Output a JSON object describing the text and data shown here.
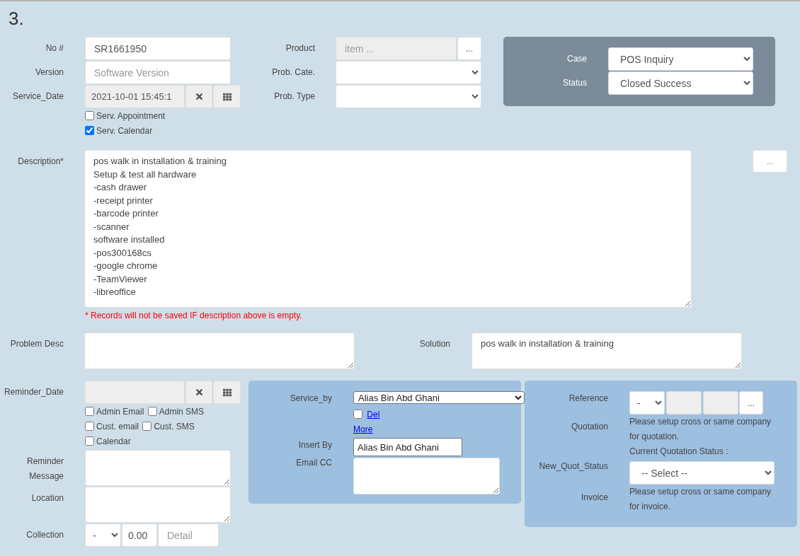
{
  "heading": "3.",
  "details": {
    "no": {
      "label": "No #",
      "value": "SR1661950"
    },
    "version": {
      "label": "Version",
      "placeholder": "Software Version"
    },
    "service_date": {
      "label": "Service_Date",
      "value": "2021-10-01 15:45:1",
      "options": [
        {
          "label": "Serv. Appointment",
          "checked": false
        },
        {
          "label": "Serv. Calendar",
          "checked": true
        }
      ]
    },
    "product": {
      "label": "Product",
      "placeholder": "item ...",
      "button": "..."
    },
    "prob_cate": {
      "label": "Prob. Cate."
    },
    "prob_type": {
      "label": "Prob. Type"
    }
  },
  "case_panel": {
    "case": {
      "label": "Case",
      "value": "POS Inquiry"
    },
    "status": {
      "label": "Status",
      "value": "Closed Success"
    }
  },
  "description": {
    "label": "Description*",
    "value": "pos walk in installation & training\nSetup & test all hardware\n-cash drawer\n-receipt printer\n-barcode printer\n-scanner\nsoftware installed\n-pos300168cs\n-google chrome\n-TeamViewer\n-libreoffice",
    "button": "...",
    "warning": "* Records will not be saved IF description above is empty."
  },
  "problem_desc": {
    "label": "Problem Desc"
  },
  "solution": {
    "label": "Solution",
    "value": "pos walk in installation & training"
  },
  "reminder": {
    "label": "Reminder_Date",
    "options": [
      {
        "label": "Admin Email",
        "checked": false
      },
      {
        "label": "Admin SMS",
        "checked": false
      },
      {
        "label": "Cust. email",
        "checked": false
      },
      {
        "label": "Cust. SMS",
        "checked": false
      },
      {
        "label": "Calendar",
        "checked": false
      }
    ],
    "message_label": "Reminder Message",
    "location_label": "Location"
  },
  "collection": {
    "label": "Collection",
    "type": "-",
    "amount": "0.00",
    "detail_placeholder": "Detail"
  },
  "service_panel": {
    "service_by": {
      "label": "Service_by",
      "value": "Alias Bin Abd Ghani"
    },
    "del": {
      "label": "Del",
      "checked": false
    },
    "more": "More",
    "insert_by": {
      "label": "Insert By",
      "value": "Alias Bin Abd Ghani"
    },
    "email_cc": {
      "label": "Email CC"
    }
  },
  "reference_panel": {
    "reference": {
      "label": "Reference",
      "value": "-",
      "button": "..."
    },
    "quotation": {
      "label": "Quotation",
      "note": "Please setup cross or same company for quotation.",
      "status": "Current Quotation Status :"
    },
    "new_quot_status": {
      "label": "New_Quot_Status",
      "value": "-- Select --"
    },
    "invoice": {
      "label": "Invoice",
      "note": "Please setup cross or same company for invoice."
    }
  }
}
